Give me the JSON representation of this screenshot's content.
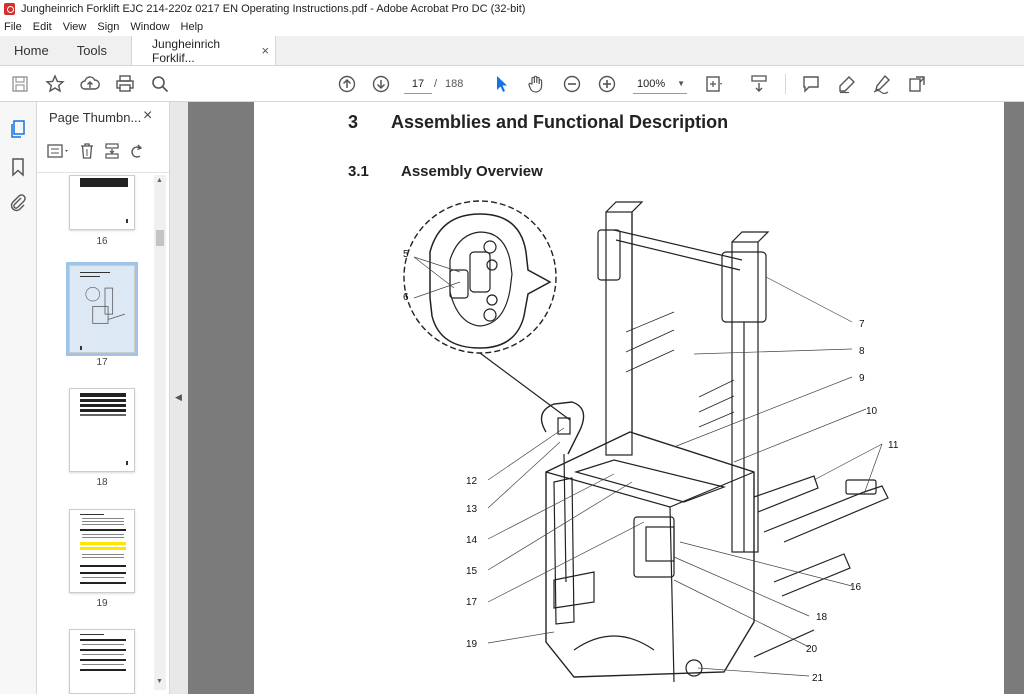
{
  "window": {
    "title": "Jungheinrich Forklift EJC 214-220z 0217 EN Operating Instructions.pdf - Adobe Acrobat Pro DC (32-bit)"
  },
  "menu": [
    "File",
    "Edit",
    "View",
    "Sign",
    "Window",
    "Help"
  ],
  "tabs": {
    "home": "Home",
    "tools": "Tools",
    "document": "Jungheinrich Forklif...",
    "close": "×"
  },
  "toolbar": {
    "current_page": "17",
    "separator": "/",
    "total_pages": "188",
    "zoom": "100%"
  },
  "thumbnail_panel": {
    "title": "Page Thumbn...",
    "close": "×",
    "pages": [
      "16",
      "17",
      "18",
      "19"
    ],
    "selected_page": "17"
  },
  "document": {
    "chapter_number": "3",
    "chapter_title": "Assemblies and Functional Description",
    "section_number": "3.1",
    "section_title": "Assembly Overview",
    "callouts": [
      "5",
      "6",
      "7",
      "8",
      "9",
      "10",
      "11",
      "12",
      "13",
      "14",
      "15",
      "16",
      "17",
      "18",
      "19",
      "20",
      "21"
    ]
  },
  "colors": {
    "accent_blue": "#1473e6",
    "selection_outline": "#9fc4e6",
    "doc_background": "#7b7b7b"
  }
}
